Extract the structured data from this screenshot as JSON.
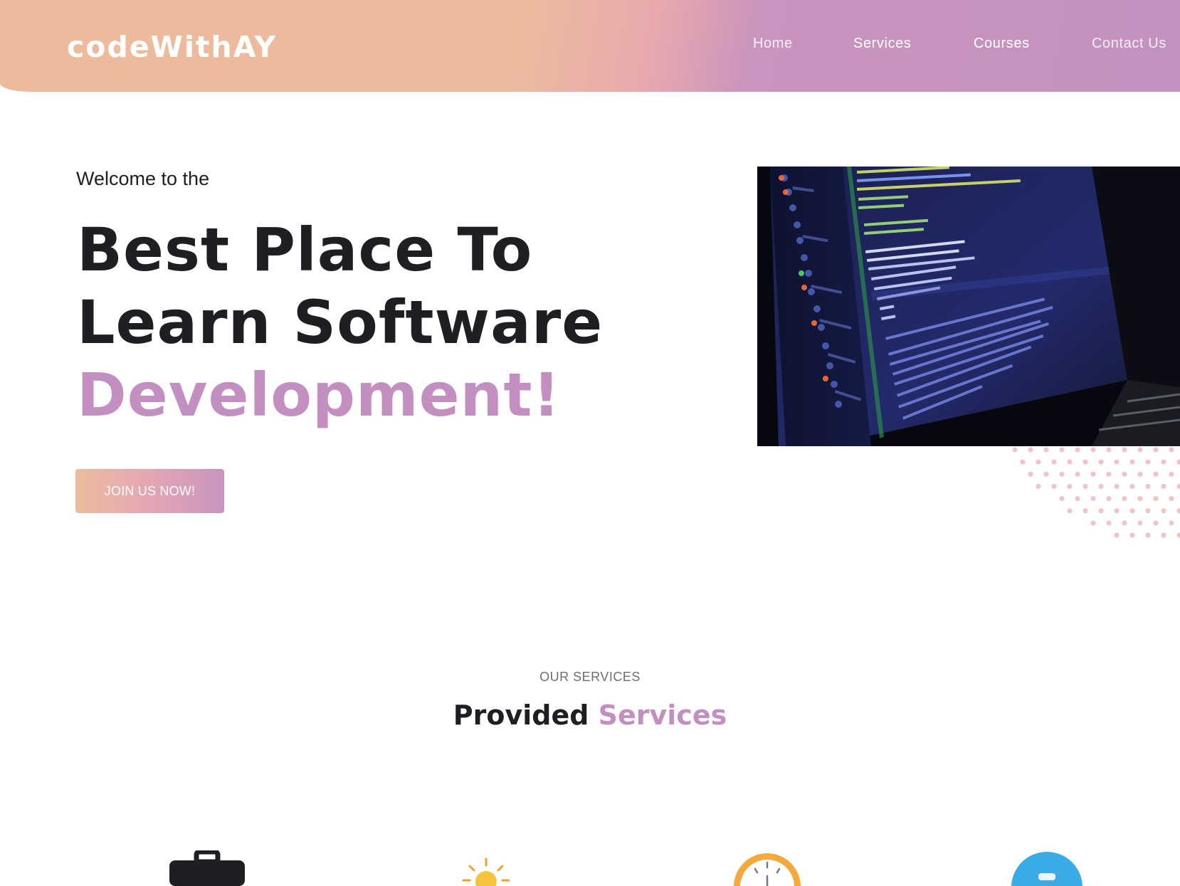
{
  "header": {
    "brand": "codeWithAY",
    "nav": [
      {
        "label": "Home"
      },
      {
        "label": "Services"
      },
      {
        "label": "Courses"
      },
      {
        "label": "Contact Us"
      }
    ]
  },
  "hero": {
    "welcome": "Welcome to the",
    "title_line1": "Best Place To",
    "title_line2": "Learn Software",
    "title_accent": "Development!",
    "cta_label": "JOIN US NOW!",
    "image_icon": "code-editor-laptop-image"
  },
  "services": {
    "kicker": "OUR SERVICES",
    "title_plain": "Provided",
    "title_accent": "Services",
    "icons": [
      "briefcase-icon",
      "sun-icon",
      "clock-icon",
      "badge-icon"
    ]
  },
  "colors": {
    "accent": "#c38fc1",
    "header_start": "#ecbb9e",
    "header_end": "#c492bf",
    "text": "#1d1f22"
  }
}
